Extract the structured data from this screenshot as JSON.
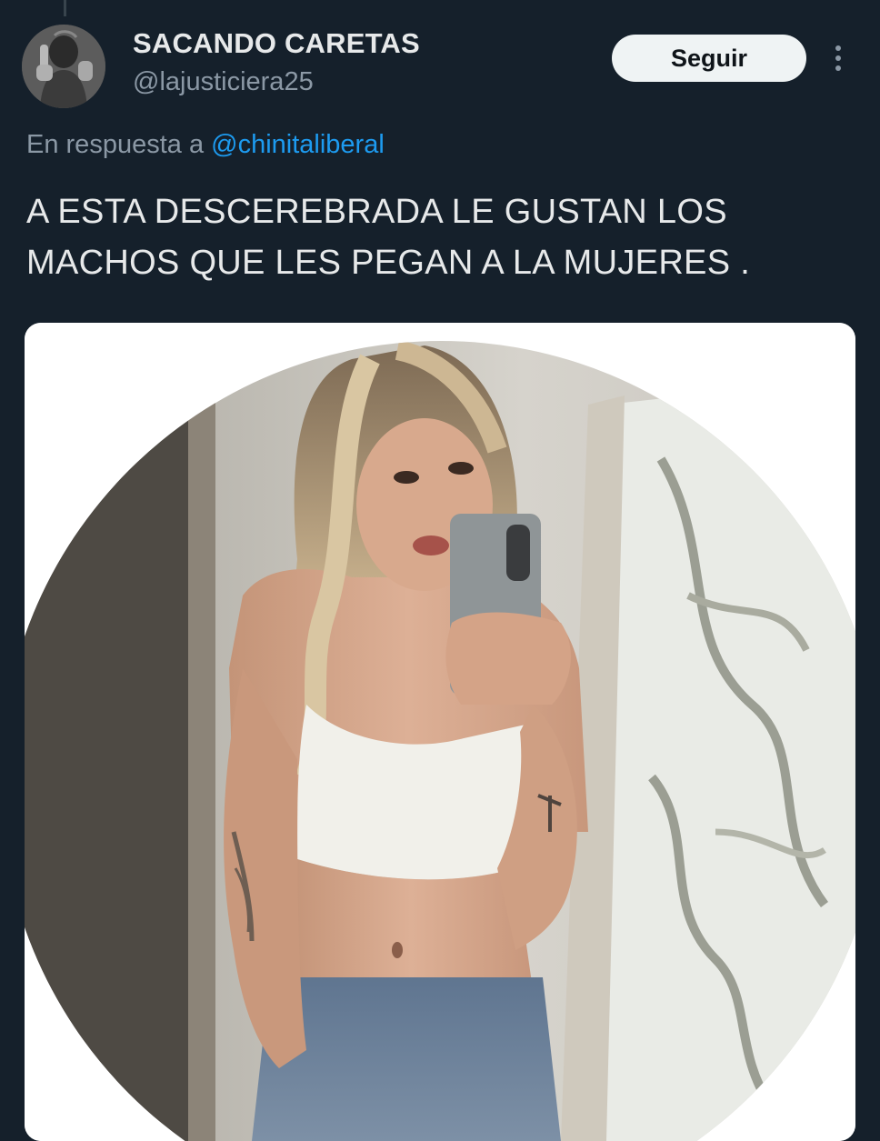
{
  "tweet": {
    "display_name": "SACANDO CARETAS",
    "handle": "@lajusticiera25",
    "follow_label": "Seguir",
    "reply_prefix": "En respuesta a",
    "reply_mention": "@chinitaliberal",
    "text": "A ESTA DESCEREBRADA LE GUSTAN LOS MACHOS QUE LES PEGAN A LA MUJERES ."
  },
  "icons": {
    "more": "more-vertical-icon"
  },
  "colors": {
    "background": "#15202b",
    "primary_text": "#e7e9ea",
    "secondary_text": "#8b98a5",
    "link": "#1d9bf0",
    "button_bg": "#eff3f4"
  }
}
